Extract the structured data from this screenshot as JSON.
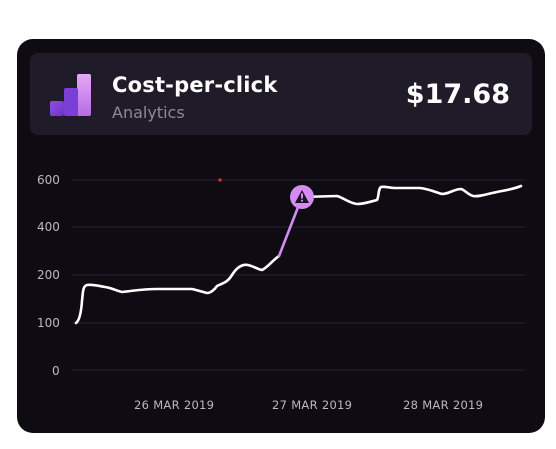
{
  "widget": {
    "title": "Cost-per-click",
    "subtitle": "Analytics",
    "value": "$17.68",
    "logo_icon": "bar-chart-icon",
    "accent_color": "#d48cf2"
  },
  "chart_data": {
    "type": "line",
    "y_ticks": [
      "600",
      "400",
      "200",
      "100",
      "0"
    ],
    "x_labels": [
      "26 MAR 2019",
      "27 MAR 2019",
      "28 MAR 2019"
    ],
    "alert_icon": "warning-icon",
    "grid": true,
    "line_color": "#ffffff",
    "highlight_color": "#d48cf2"
  }
}
